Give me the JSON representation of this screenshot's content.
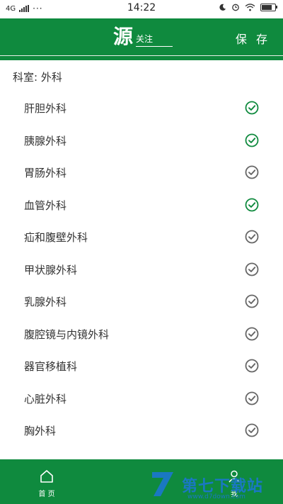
{
  "status_bar": {
    "network": "4G",
    "dots": "···",
    "time": "14:22",
    "battery_level": 0.8
  },
  "header": {
    "logo_glyph": "源",
    "logo_text": "关注",
    "save_label": "保 存",
    "bg_color": "#0f8a3e"
  },
  "department": {
    "title": "科室: 外科"
  },
  "items": [
    {
      "label": "肝胆外科",
      "selected": true
    },
    {
      "label": "胰腺外科",
      "selected": true
    },
    {
      "label": "胃肠外科",
      "selected": false
    },
    {
      "label": "血管外科",
      "selected": true
    },
    {
      "label": "疝和腹壁外科",
      "selected": false
    },
    {
      "label": "甲状腺外科",
      "selected": false
    },
    {
      "label": "乳腺外科",
      "selected": false
    },
    {
      "label": "腹腔镜与内镜外科",
      "selected": false
    },
    {
      "label": "器官移植科",
      "selected": false
    },
    {
      "label": "心脏外科",
      "selected": false
    },
    {
      "label": "胸外科",
      "selected": false
    }
  ],
  "colors": {
    "accent": "#0f8a3e",
    "unselected": "#666666"
  },
  "bottom_nav": {
    "home_label": "首 页",
    "mine_label": "我"
  },
  "watermark": {
    "text": "第七下载站",
    "url": "www.d7down.com"
  }
}
